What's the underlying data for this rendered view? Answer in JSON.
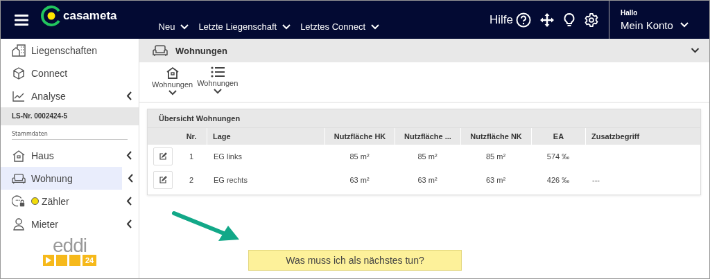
{
  "header": {
    "logo": "casameta",
    "menus": [
      {
        "label": "Neu"
      },
      {
        "label": "Letzte Liegenschaft"
      },
      {
        "label": "Letztes Connect"
      }
    ],
    "help": "Hilfe",
    "greeting": "Hallo",
    "account": "Mein Konto"
  },
  "sidebar": {
    "top_items": [
      {
        "label": "Liegenschaften",
        "submenu": false
      },
      {
        "label": "Connect",
        "submenu": false
      },
      {
        "label": "Analyse",
        "submenu": true
      }
    ],
    "property": "LS-Nr. 0002424-5",
    "section": "Stammdaten",
    "items": [
      {
        "label": "Haus",
        "submenu": true,
        "selected": false
      },
      {
        "label": "Wohnung",
        "submenu": true,
        "selected": true
      },
      {
        "label": "Zähler",
        "submenu": true,
        "selected": false,
        "color": "#f2dc0a"
      },
      {
        "label": "Mieter",
        "submenu": true,
        "selected": false
      }
    ],
    "brand": {
      "word": "eddi",
      "badge": "24"
    }
  },
  "page": {
    "title": "Wohnungen",
    "toolbar": [
      {
        "label": "Wohnungen"
      },
      {
        "label": "Wohnungen"
      }
    ]
  },
  "table": {
    "title": "Übersicht Wohnungen",
    "columns": [
      "Nr.",
      "Lage",
      "Nutzfläche HK",
      "Nutzfläche ...",
      "Nutzfläche NK",
      "EA",
      "Zusatzbegriff"
    ],
    "rows": [
      {
        "cells": [
          "1",
          "EG links",
          "85 m²",
          "85 m²",
          "85 m²",
          "574 ‰"
        ]
      },
      {
        "cells": [
          "2",
          "EG rechts",
          "63 m²",
          "63 m²",
          "63 m²",
          "426 ‰",
          "---"
        ]
      }
    ]
  },
  "next_step": "Was muss ich als nächstes tun?"
}
